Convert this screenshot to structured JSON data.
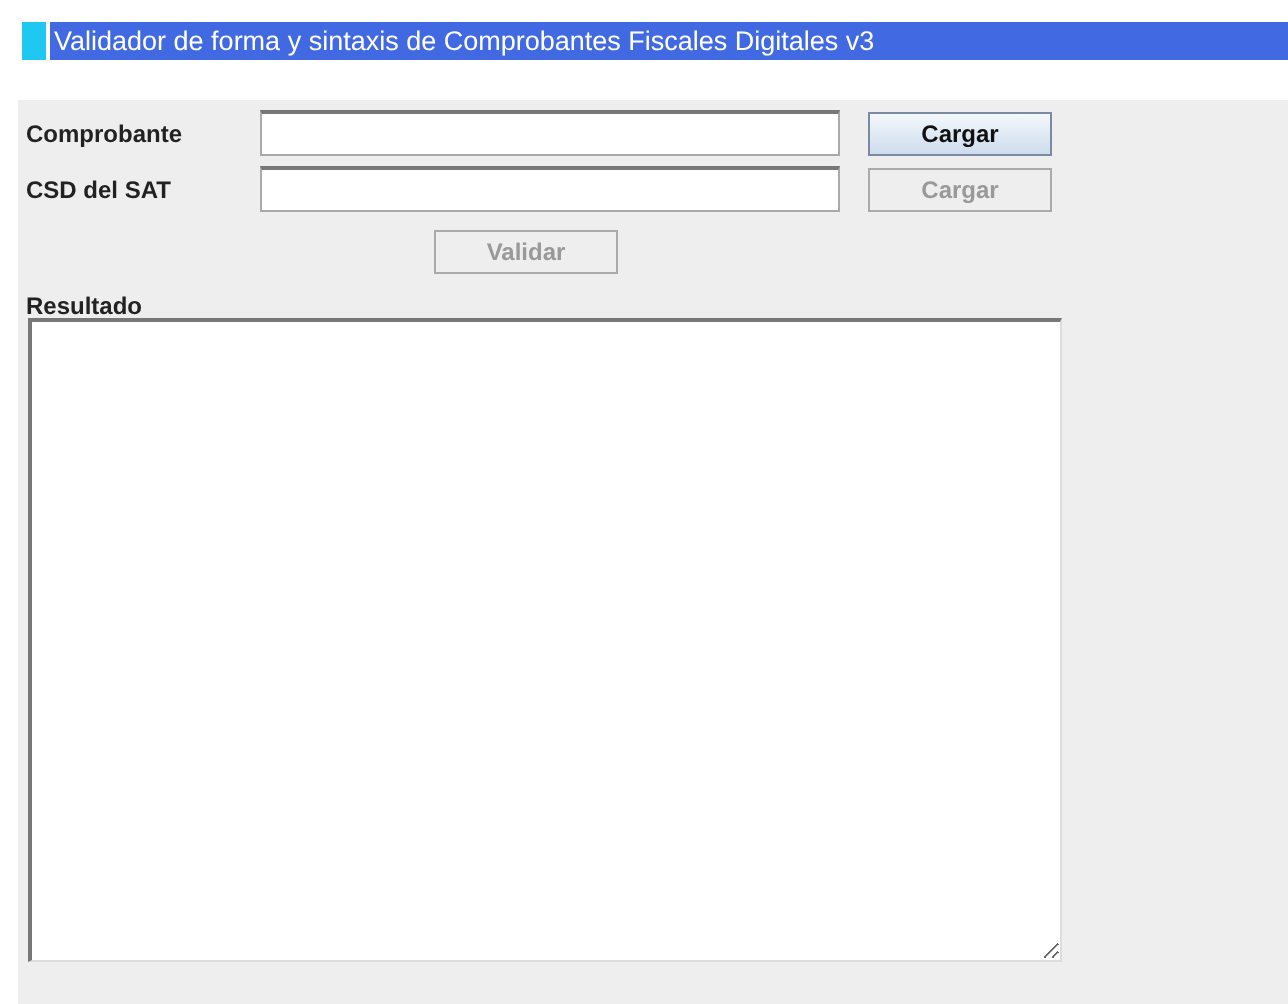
{
  "window": {
    "title": "Validador de forma y sintaxis de Comprobantes Fiscales Digitales v3"
  },
  "fields": [
    {
      "label": "Comprobante",
      "button": {
        "label": "Cargar",
        "disabled": false
      }
    },
    {
      "label": "CSD del SAT",
      "button": {
        "label": "Cargar",
        "disabled": true
      }
    }
  ],
  "validate_button": {
    "label": "Validar",
    "disabled": true
  },
  "result": {
    "label": "Resultado"
  }
}
